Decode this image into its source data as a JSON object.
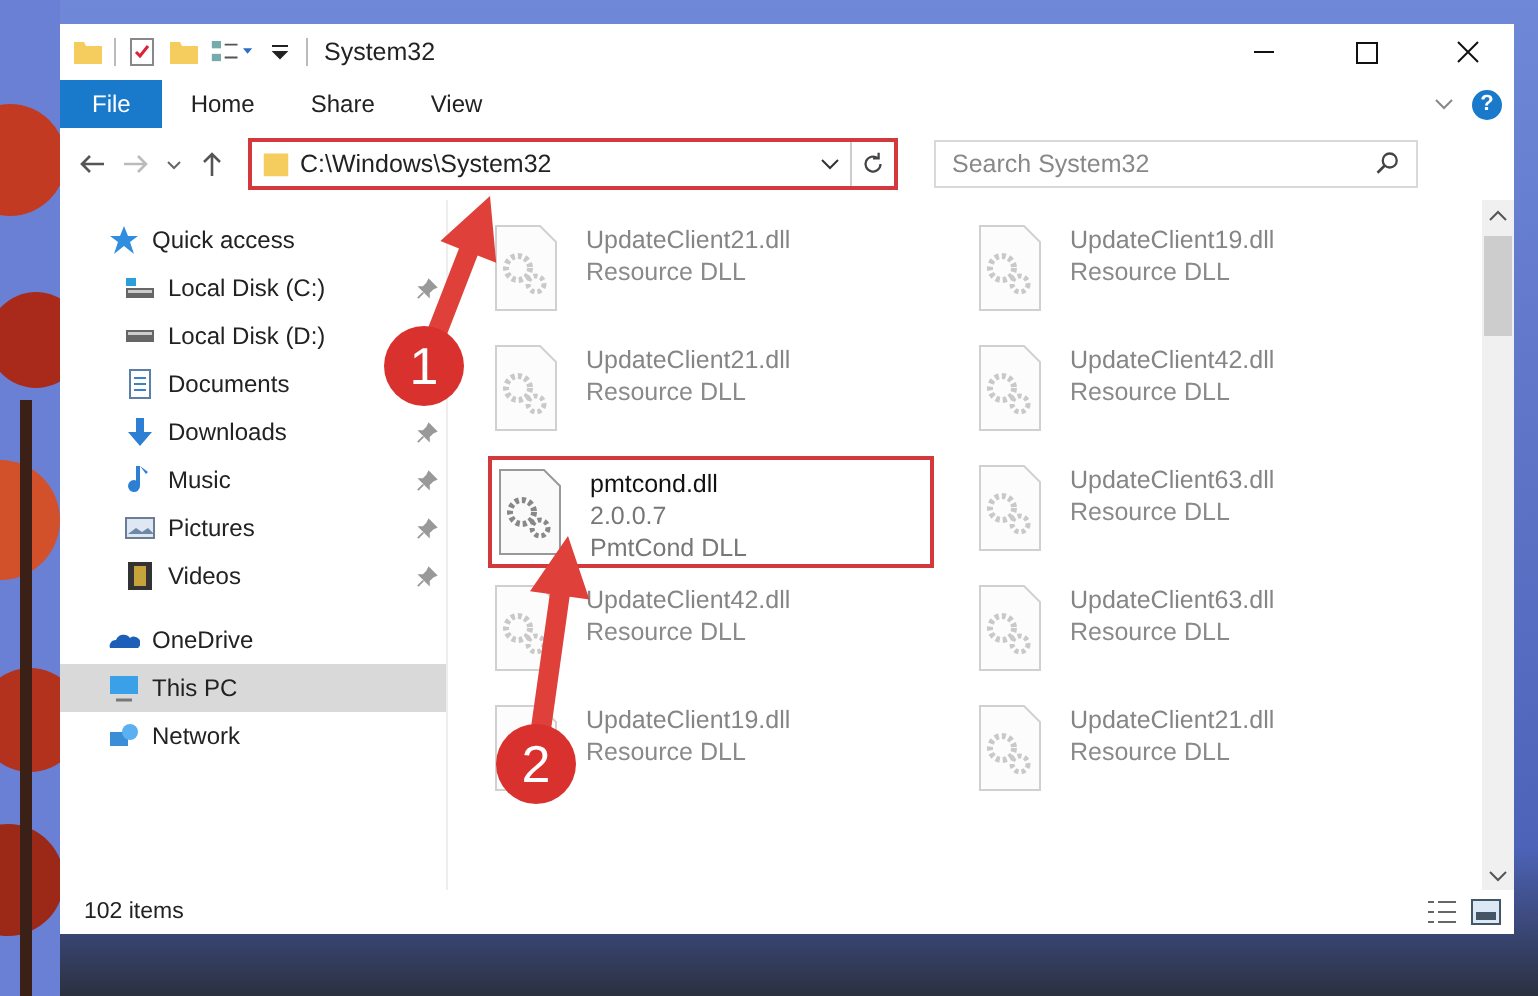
{
  "window": {
    "title": "System32"
  },
  "ribbon": {
    "tabs": [
      {
        "label": "File",
        "selected": true
      },
      {
        "label": "Home",
        "selected": false
      },
      {
        "label": "Share",
        "selected": false
      },
      {
        "label": "View",
        "selected": false
      }
    ],
    "help": "?"
  },
  "address": {
    "path": "C:\\Windows\\System32",
    "highlighted": true
  },
  "search": {
    "placeholder": "Search System32"
  },
  "sidebar": {
    "items": [
      {
        "label": "Quick access",
        "selected": false,
        "children": [
          {
            "label": "Local Disk (C:)",
            "pinned": true
          },
          {
            "label": "Local Disk (D:)",
            "pinned": false
          },
          {
            "label": "Documents",
            "pinned": false
          },
          {
            "label": "Downloads",
            "pinned": true
          },
          {
            "label": "Music",
            "pinned": true
          },
          {
            "label": "Pictures",
            "pinned": true
          },
          {
            "label": "Videos",
            "pinned": true
          }
        ]
      },
      {
        "label": "OneDrive",
        "selected": false
      },
      {
        "label": "This PC",
        "selected": true
      },
      {
        "label": "Network",
        "selected": false
      }
    ]
  },
  "files": [
    {
      "name": "UpdateClient21.dll",
      "details": [
        "Resource DLL"
      ],
      "blurred": true,
      "highlighted": false
    },
    {
      "name": "UpdateClient19.dll",
      "details": [
        "Resource DLL"
      ],
      "blurred": true,
      "highlighted": false
    },
    {
      "name": "UpdateClient21.dll",
      "details": [
        "Resource DLL"
      ],
      "blurred": true,
      "highlighted": false
    },
    {
      "name": "UpdateClient42.dll",
      "details": [
        "Resource DLL"
      ],
      "blurred": true,
      "highlighted": false
    },
    {
      "name": "pmtcond.dll",
      "details": [
        "2.0.0.7",
        "PmtCond DLL"
      ],
      "blurred": false,
      "highlighted": true
    },
    {
      "name": "UpdateClient63.dll",
      "details": [
        "Resource DLL"
      ],
      "blurred": true,
      "highlighted": false
    },
    {
      "name": "UpdateClient42.dll",
      "details": [
        "Resource DLL"
      ],
      "blurred": true,
      "highlighted": false
    },
    {
      "name": "UpdateClient63.dll",
      "details": [
        "Resource DLL"
      ],
      "blurred": true,
      "highlighted": false
    },
    {
      "name": "UpdateClient19.dll",
      "details": [
        "Resource DLL"
      ],
      "blurred": true,
      "highlighted": false
    },
    {
      "name": "UpdateClient21.dll",
      "details": [
        "Resource DLL"
      ],
      "blurred": true,
      "highlighted": false
    }
  ],
  "status_bar": {
    "count": "102 items"
  },
  "callouts": [
    {
      "number": "1"
    },
    {
      "number": "2"
    }
  ]
}
